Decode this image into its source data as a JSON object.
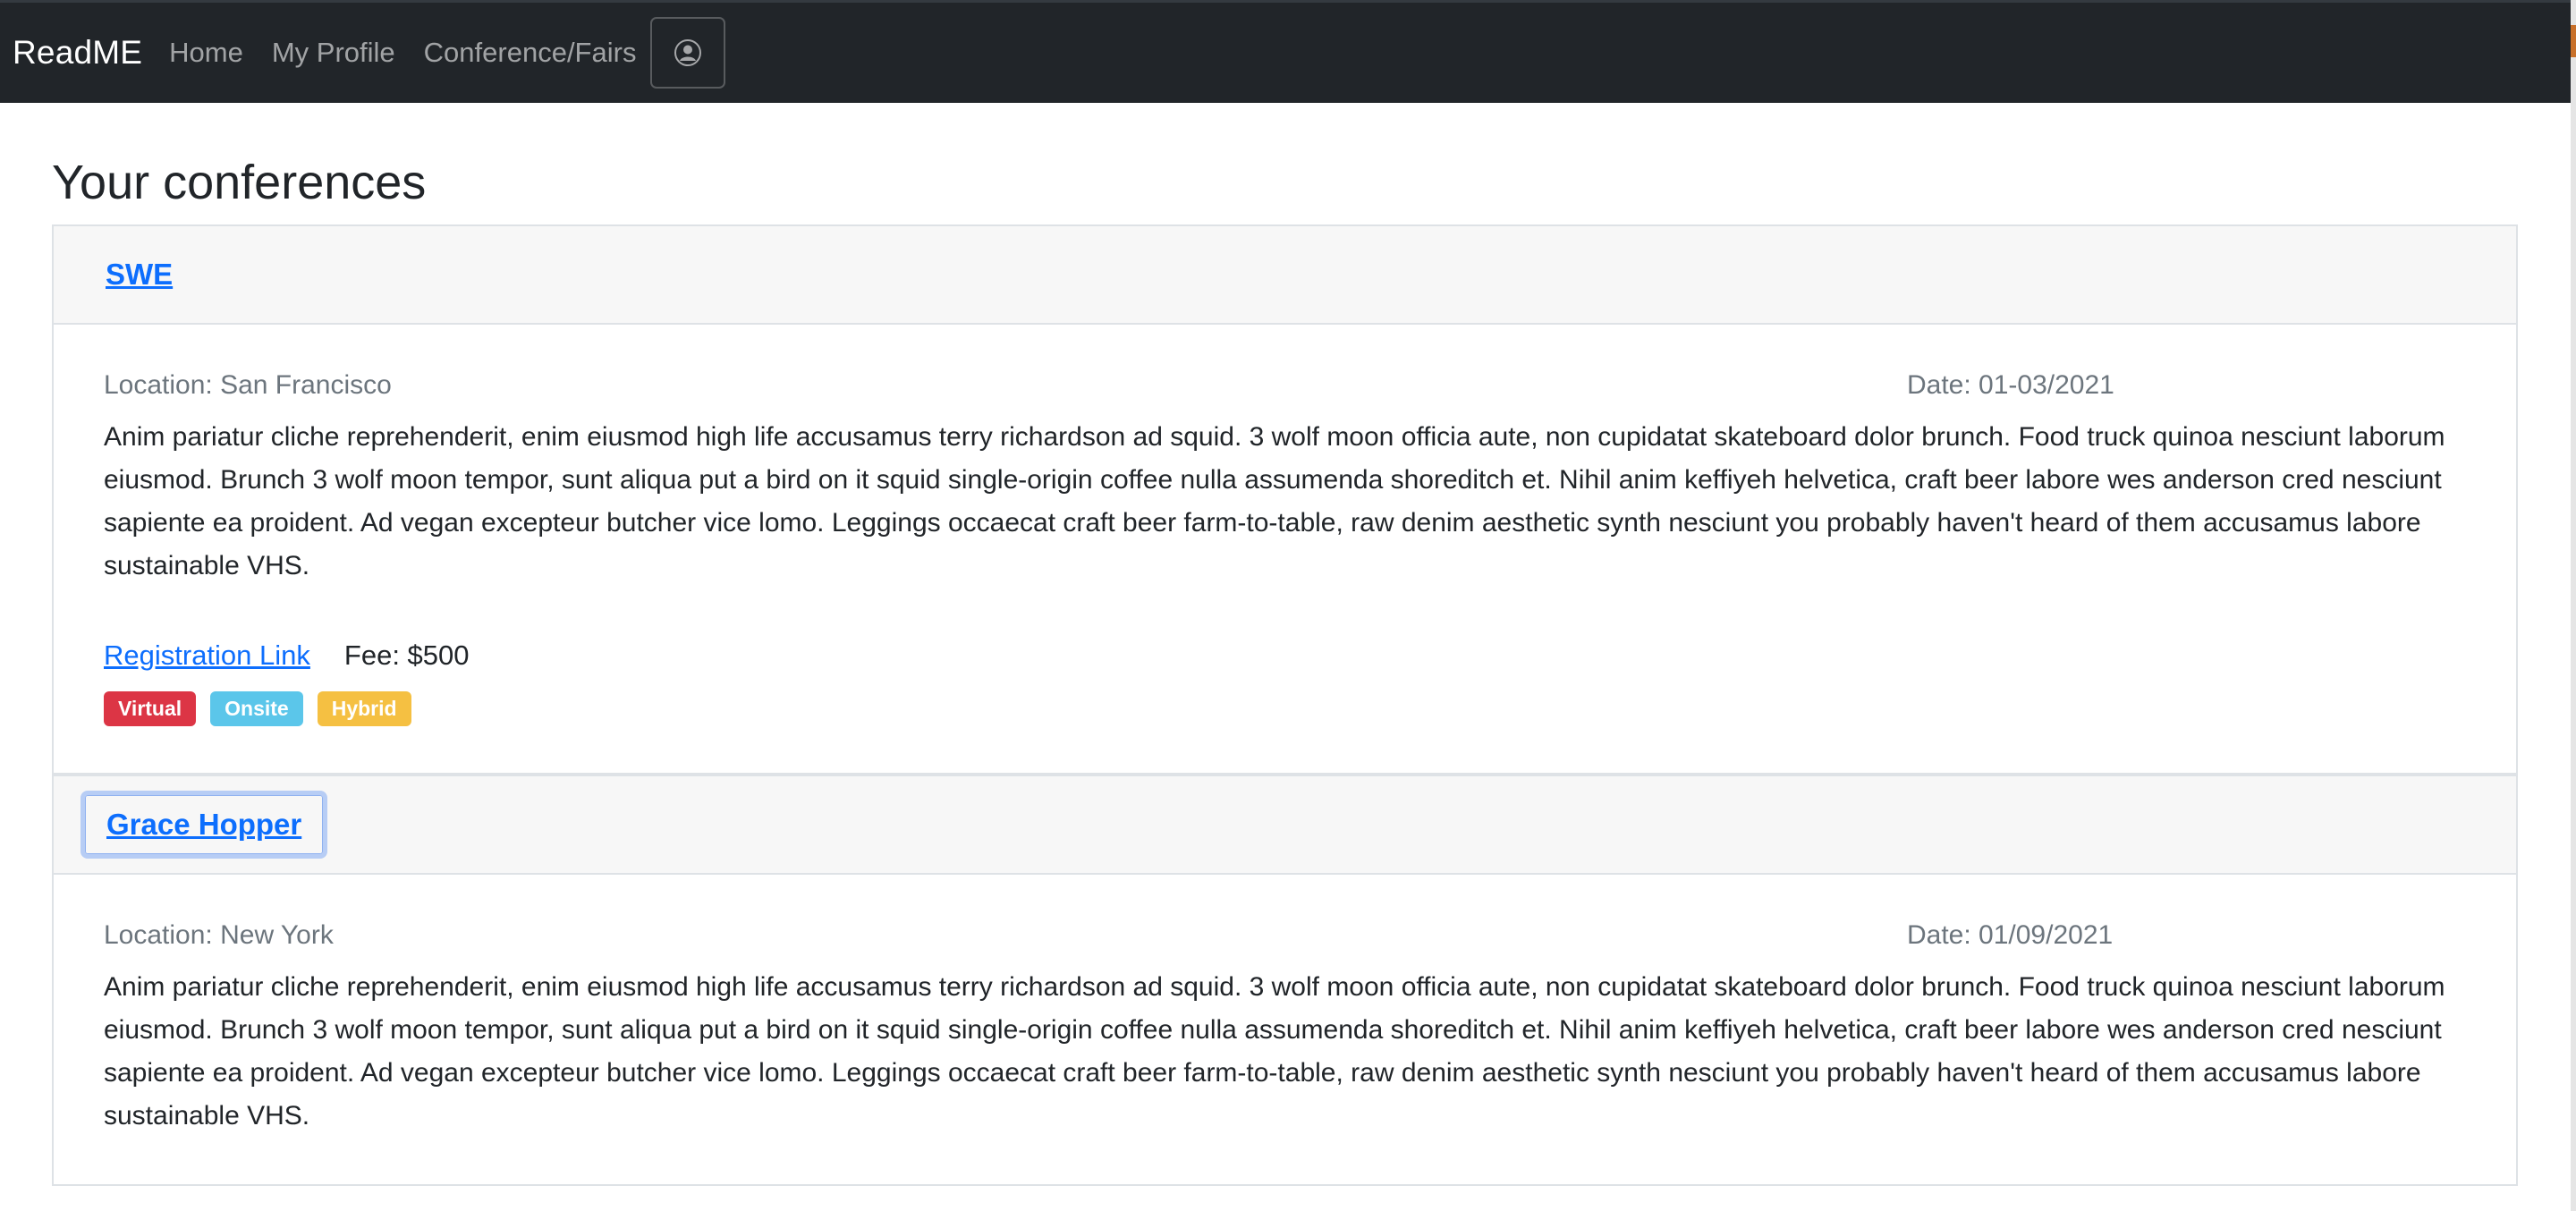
{
  "nav": {
    "brand": "ReadME",
    "links": [
      "Home",
      "My Profile",
      "Conference/Fairs"
    ]
  },
  "page_title": "Your conferences",
  "conferences": [
    {
      "name": "SWE",
      "location": "Location: San Francisco",
      "date": "Date: 01-03/2021",
      "description": "Anim pariatur cliche reprehenderit, enim eiusmod high life accusamus terry richardson ad squid. 3 wolf moon officia aute, non cupidatat skateboard dolor brunch. Food truck quinoa nesciunt laborum eiusmod. Brunch 3 wolf moon tempor, sunt aliqua put a bird on it squid single-origin coffee nulla assumenda shoreditch et. Nihil anim keffiyeh helvetica, craft beer labore wes anderson cred nesciunt sapiente ea proident. Ad vegan excepteur butcher vice lomo. Leggings occaecat craft beer farm-to-table, raw denim aesthetic synth nesciunt you probably haven't heard of them accusamus labore sustainable VHS.",
      "registration_label": "Registration Link",
      "fee": "Fee: $500",
      "badges": [
        {
          "label": "Virtual",
          "color": "#dc3545"
        },
        {
          "label": "Onsite",
          "color": "#5bc6ea"
        },
        {
          "label": "Hybrid",
          "color": "#f5c042"
        }
      ]
    },
    {
      "name": "Grace Hopper",
      "location": "Location: New York",
      "date": "Date: 01/09/2021",
      "description": "Anim pariatur cliche reprehenderit, enim eiusmod high life accusamus terry richardson ad squid. 3 wolf moon officia aute, non cupidatat skateboard dolor brunch. Food truck quinoa nesciunt laborum eiusmod. Brunch 3 wolf moon tempor, sunt aliqua put a bird on it squid single-origin coffee nulla assumenda shoreditch et. Nihil anim keffiyeh helvetica, craft beer labore wes anderson cred nesciunt sapiente ea proident. Ad vegan excepteur butcher vice lomo. Leggings occaecat craft beer farm-to-table, raw denim aesthetic synth nesciunt you probably haven't heard of them accusamus labore sustainable VHS."
    }
  ],
  "icons": {
    "profile": "user-circle-icon"
  }
}
